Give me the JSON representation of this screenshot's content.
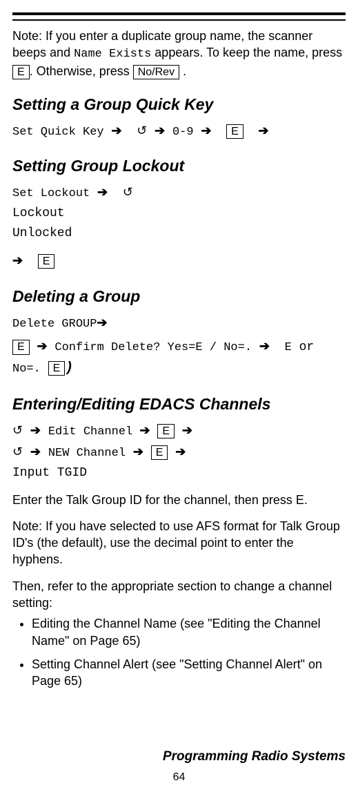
{
  "rules": {},
  "intro": {
    "pre": "Note: If you enter a duplicate group name, the scanner beeps and ",
    "name_exists": "Name Exists",
    "mid": " appears. To keep the name, press ",
    "key_e": "E",
    "mid2": ". Otherwise, press ",
    "key_norev": "No/Rev",
    "post": " ."
  },
  "sec1": {
    "title": "Setting a Group Quick Key",
    "t1": "Set Quick Key",
    "arr": "➔",
    "dial": "↺",
    "t2": "0-9",
    "key_e": "E"
  },
  "sec2": {
    "title": "Setting Group Lockout",
    "t1": "Set Lockout",
    "arr": "➔",
    "dial": "↺",
    "opt1": "Lockout",
    "opt2": "Unlocked",
    "key_e": "E"
  },
  "sec3": {
    "title": "Deleting a Group",
    "t1": "Delete GROUP",
    "arr": "➔",
    "key_e": "E",
    "t2": "Confirm Delete? Yes=E / No=.",
    "t3": "E",
    "or": "or",
    "t4": "No=.",
    "paren": ")"
  },
  "sec4": {
    "title": "Entering/Editing EDACS Channels",
    "dial": "↺",
    "arr": "➔",
    "t1": " Edit Channel ",
    "key_e": "E",
    "t2": "NEW Channel",
    "t3": "Input TGID",
    "para1": "Enter the Talk Group ID for the channel, then press E.",
    "para2": "Note: If you have selected to use AFS format for Talk Group ID's (the default), use the decimal point to enter the hyphens.",
    "para3": "Then, refer to the appropriate section to change a channel setting:",
    "bul1": "Editing the Channel Name (see \"Editing the Channel Name\" on Page 65)",
    "bul2": "Setting Channel Alert (see \"Setting Channel Alert\" on Page 65)"
  },
  "footer": {
    "title": "Programming Radio Systems",
    "page": "64"
  }
}
